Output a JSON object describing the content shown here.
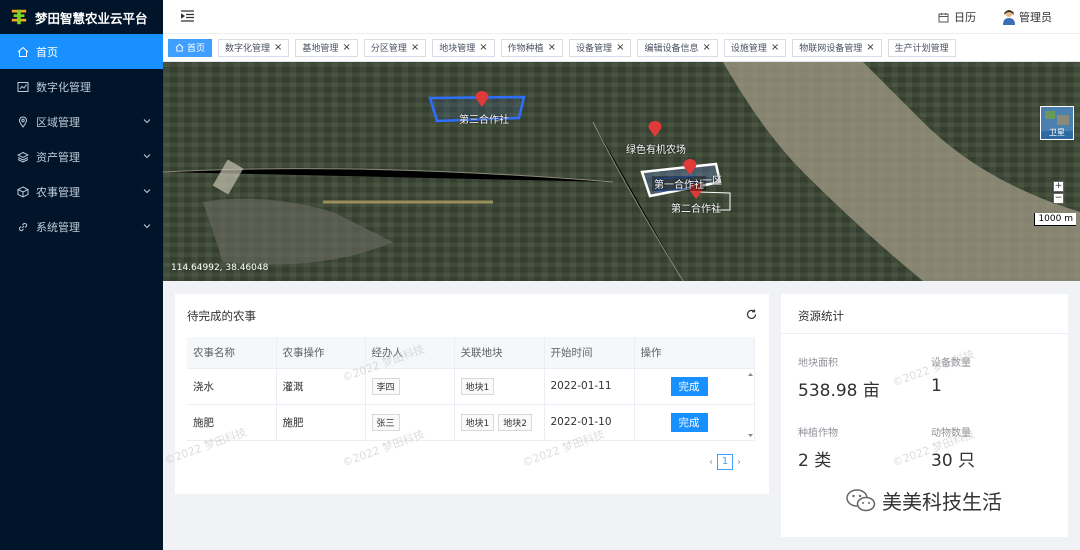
{
  "app": {
    "title": "梦田智慧农业云平台"
  },
  "sidebar": {
    "items": [
      {
        "label": "首页",
        "icon": "home-icon",
        "active": true,
        "expandable": false
      },
      {
        "label": "数字化管理",
        "icon": "chart-icon",
        "active": false,
        "expandable": false
      },
      {
        "label": "区域管理",
        "icon": "location-icon",
        "active": false,
        "expandable": true
      },
      {
        "label": "资产管理",
        "icon": "layers-icon",
        "active": false,
        "expandable": true
      },
      {
        "label": "农事管理",
        "icon": "cube-icon",
        "active": false,
        "expandable": true
      },
      {
        "label": "系统管理",
        "icon": "link-icon",
        "active": false,
        "expandable": true
      }
    ]
  },
  "header": {
    "calendar_label": "日历",
    "user_label": "管理员"
  },
  "tabs": [
    {
      "label": "首页",
      "active": true
    },
    {
      "label": "数字化管理",
      "active": false
    },
    {
      "label": "基地管理",
      "active": false
    },
    {
      "label": "分区管理",
      "active": false
    },
    {
      "label": "地块管理",
      "active": false
    },
    {
      "label": "作物种植",
      "active": false
    },
    {
      "label": "设备管理",
      "active": false
    },
    {
      "label": "编辑设备信息",
      "active": false
    },
    {
      "label": "设施管理",
      "active": false
    },
    {
      "label": "物联网设备管理",
      "active": false
    },
    {
      "label": "生产计划管理",
      "active": false
    }
  ],
  "map": {
    "coords": "114.64992, 38.46048",
    "labels": [
      "第三合作社",
      "绿色有机农场",
      "第一合作社",
      "一区",
      "第二合作社"
    ],
    "satellite_label": "卫星",
    "zoom_in": "+",
    "zoom_out": "−",
    "scale": "1000 m"
  },
  "tasks": {
    "title": "待完成的农事",
    "columns": [
      "农事名称",
      "农事操作",
      "经办人",
      "关联地块",
      "开始时间",
      "操作"
    ],
    "rows": [
      {
        "name": "浇水",
        "op": "灌溉",
        "handler": "李四",
        "plots": [
          "地块1"
        ],
        "start": "2022-01-11",
        "action": "完成"
      },
      {
        "name": "施肥",
        "op": "施肥",
        "handler": "张三",
        "plots": [
          "地块1",
          "地块2"
        ],
        "start": "2022-01-10",
        "action": "完成"
      }
    ],
    "page": "1"
  },
  "stats": {
    "title": "资源统计",
    "items": [
      {
        "label": "地块面积",
        "value": "538.98 亩"
      },
      {
        "label": "设备数量",
        "value": "1"
      },
      {
        "label": "种植作物",
        "value": "2 类"
      },
      {
        "label": "动物数量",
        "value": "30 只"
      }
    ]
  },
  "watermark": "©2022 梦田科技",
  "wechat": "美美科技生活",
  "colors": {
    "sidebar_bg": "#001529",
    "accent": "#1890ff",
    "tab_active": "#409eff"
  }
}
